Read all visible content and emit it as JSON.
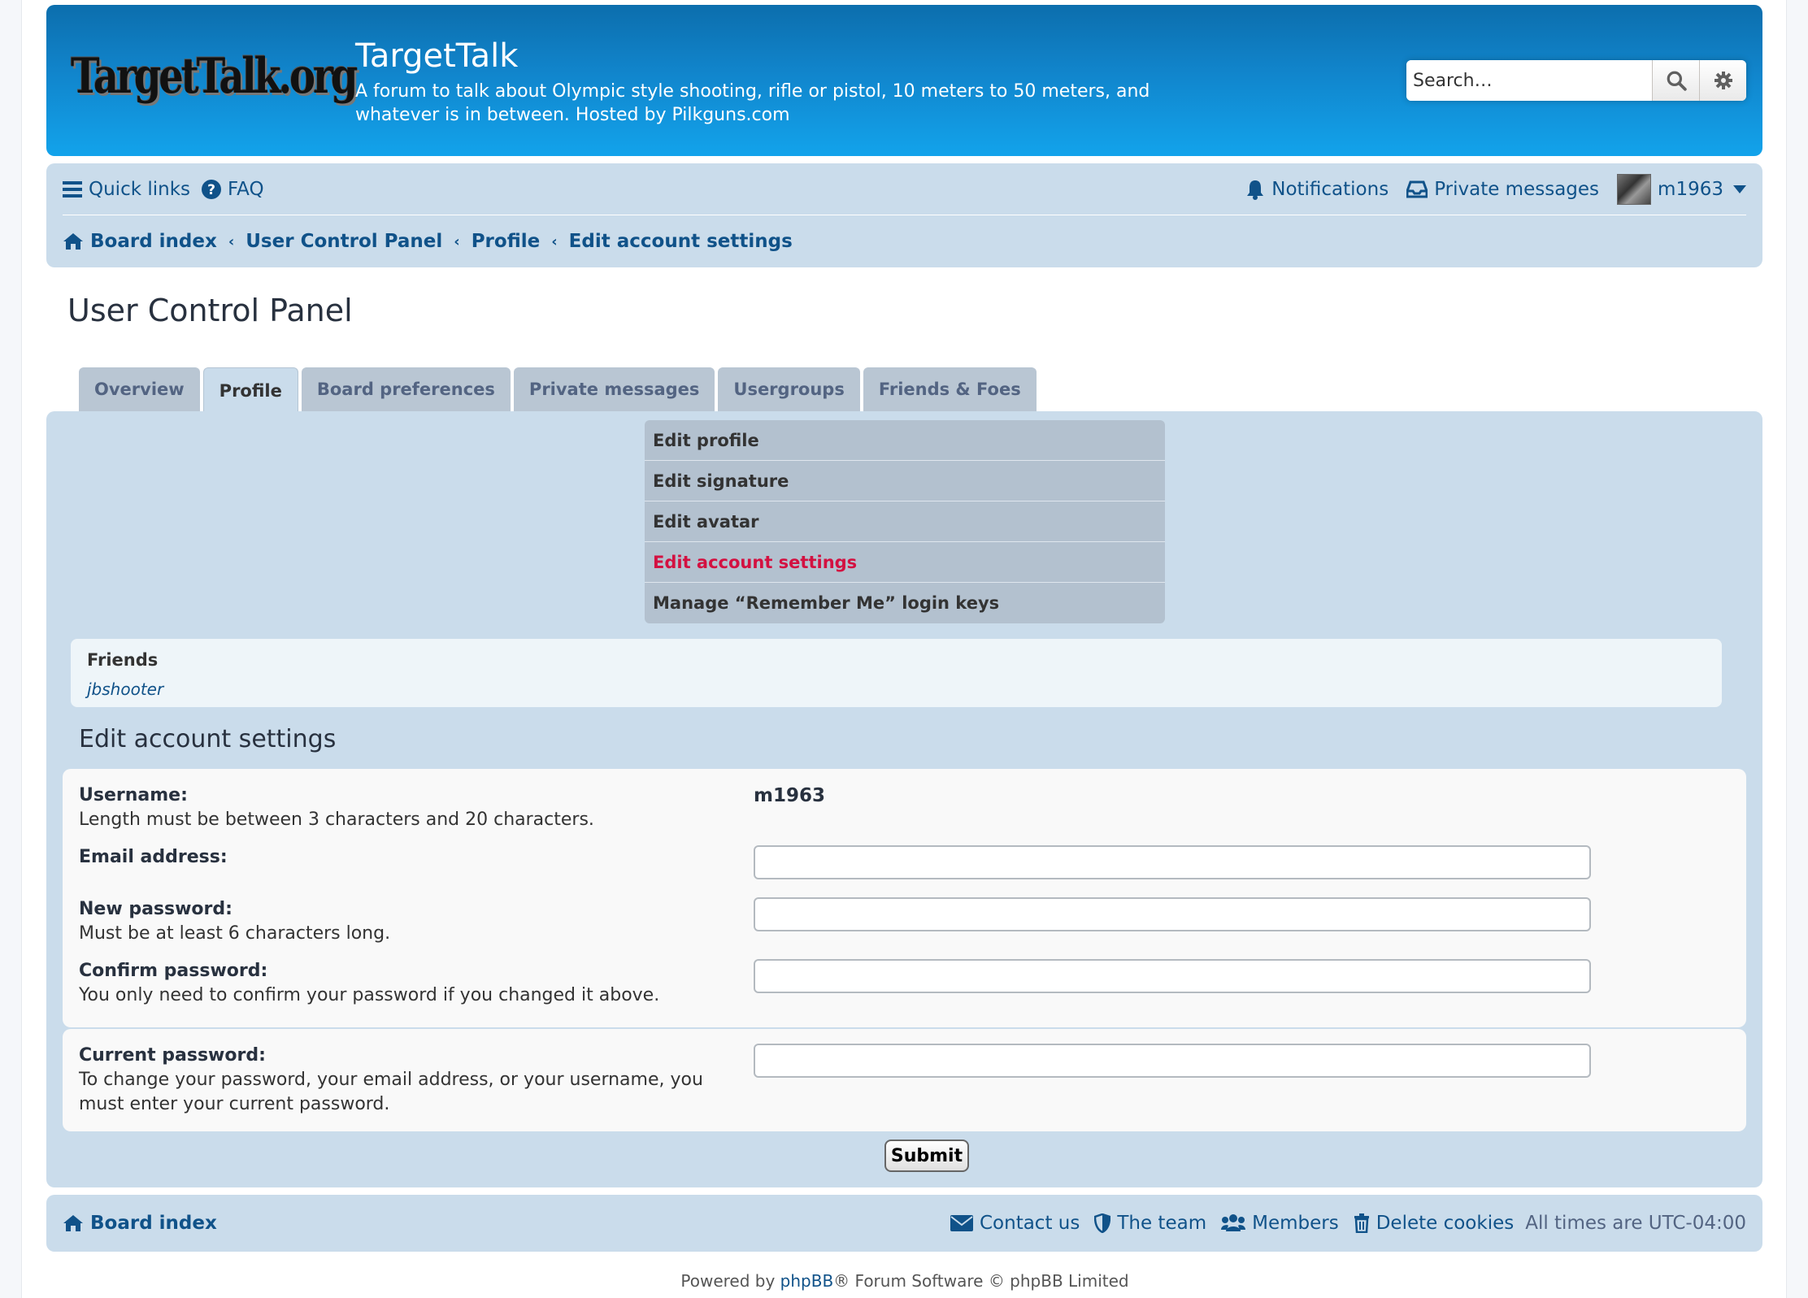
{
  "header": {
    "logo_text": "TargetTalk.org",
    "site_title": "TargetTalk",
    "site_description": "A forum to talk about Olympic style shooting, rifle or pistol, 10 meters to 50 meters, and whatever is in between. Hosted by Pilkguns.com",
    "search_placeholder": "Search…"
  },
  "navbar": {
    "quick_links": "Quick links",
    "faq": "FAQ",
    "notifications": "Notifications",
    "private_messages": "Private messages",
    "username": "m1963",
    "breadcrumbs": [
      "Board index",
      "User Control Panel",
      "Profile",
      "Edit account settings"
    ]
  },
  "page_title": "User Control Panel",
  "tabs": [
    "Overview",
    "Profile",
    "Board preferences",
    "Private messages",
    "Usergroups",
    "Friends & Foes"
  ],
  "active_tab": "Profile",
  "submenu": [
    "Edit profile",
    "Edit signature",
    "Edit avatar",
    "Edit account settings",
    "Manage “Remember Me” login keys"
  ],
  "friends": {
    "title": "Friends",
    "list": [
      "jbshooter"
    ]
  },
  "section_heading": "Edit account settings",
  "form": {
    "username_label": "Username:",
    "username_explain": "Length must be between 3 characters and 20 characters.",
    "username_value": "m1963",
    "email_label": "Email address:",
    "new_password_label": "New password:",
    "new_password_explain": "Must be at least 6 characters long.",
    "confirm_password_label": "Confirm password:",
    "confirm_password_explain": "You only need to confirm your password if you changed it above.",
    "current_password_label": "Current password:",
    "current_password_explain": "To change your password, your email address, or your username, you must enter your current password.",
    "submit": "Submit"
  },
  "footer": {
    "board_index": "Board index",
    "contact_us": "Contact us",
    "the_team": "The team",
    "members": "Members",
    "delete_cookies": "Delete cookies",
    "timezone": "All times are UTC-04:00",
    "powered_by_prefix": "Powered by ",
    "powered_by_link": "phpBB",
    "powered_by_suffix": "® Forum Software © phpBB Limited"
  },
  "colors": {
    "header_blue": "#0c6ead",
    "panel_bg": "#cadceb",
    "link": "#105289",
    "active_menu": "#d31141"
  }
}
